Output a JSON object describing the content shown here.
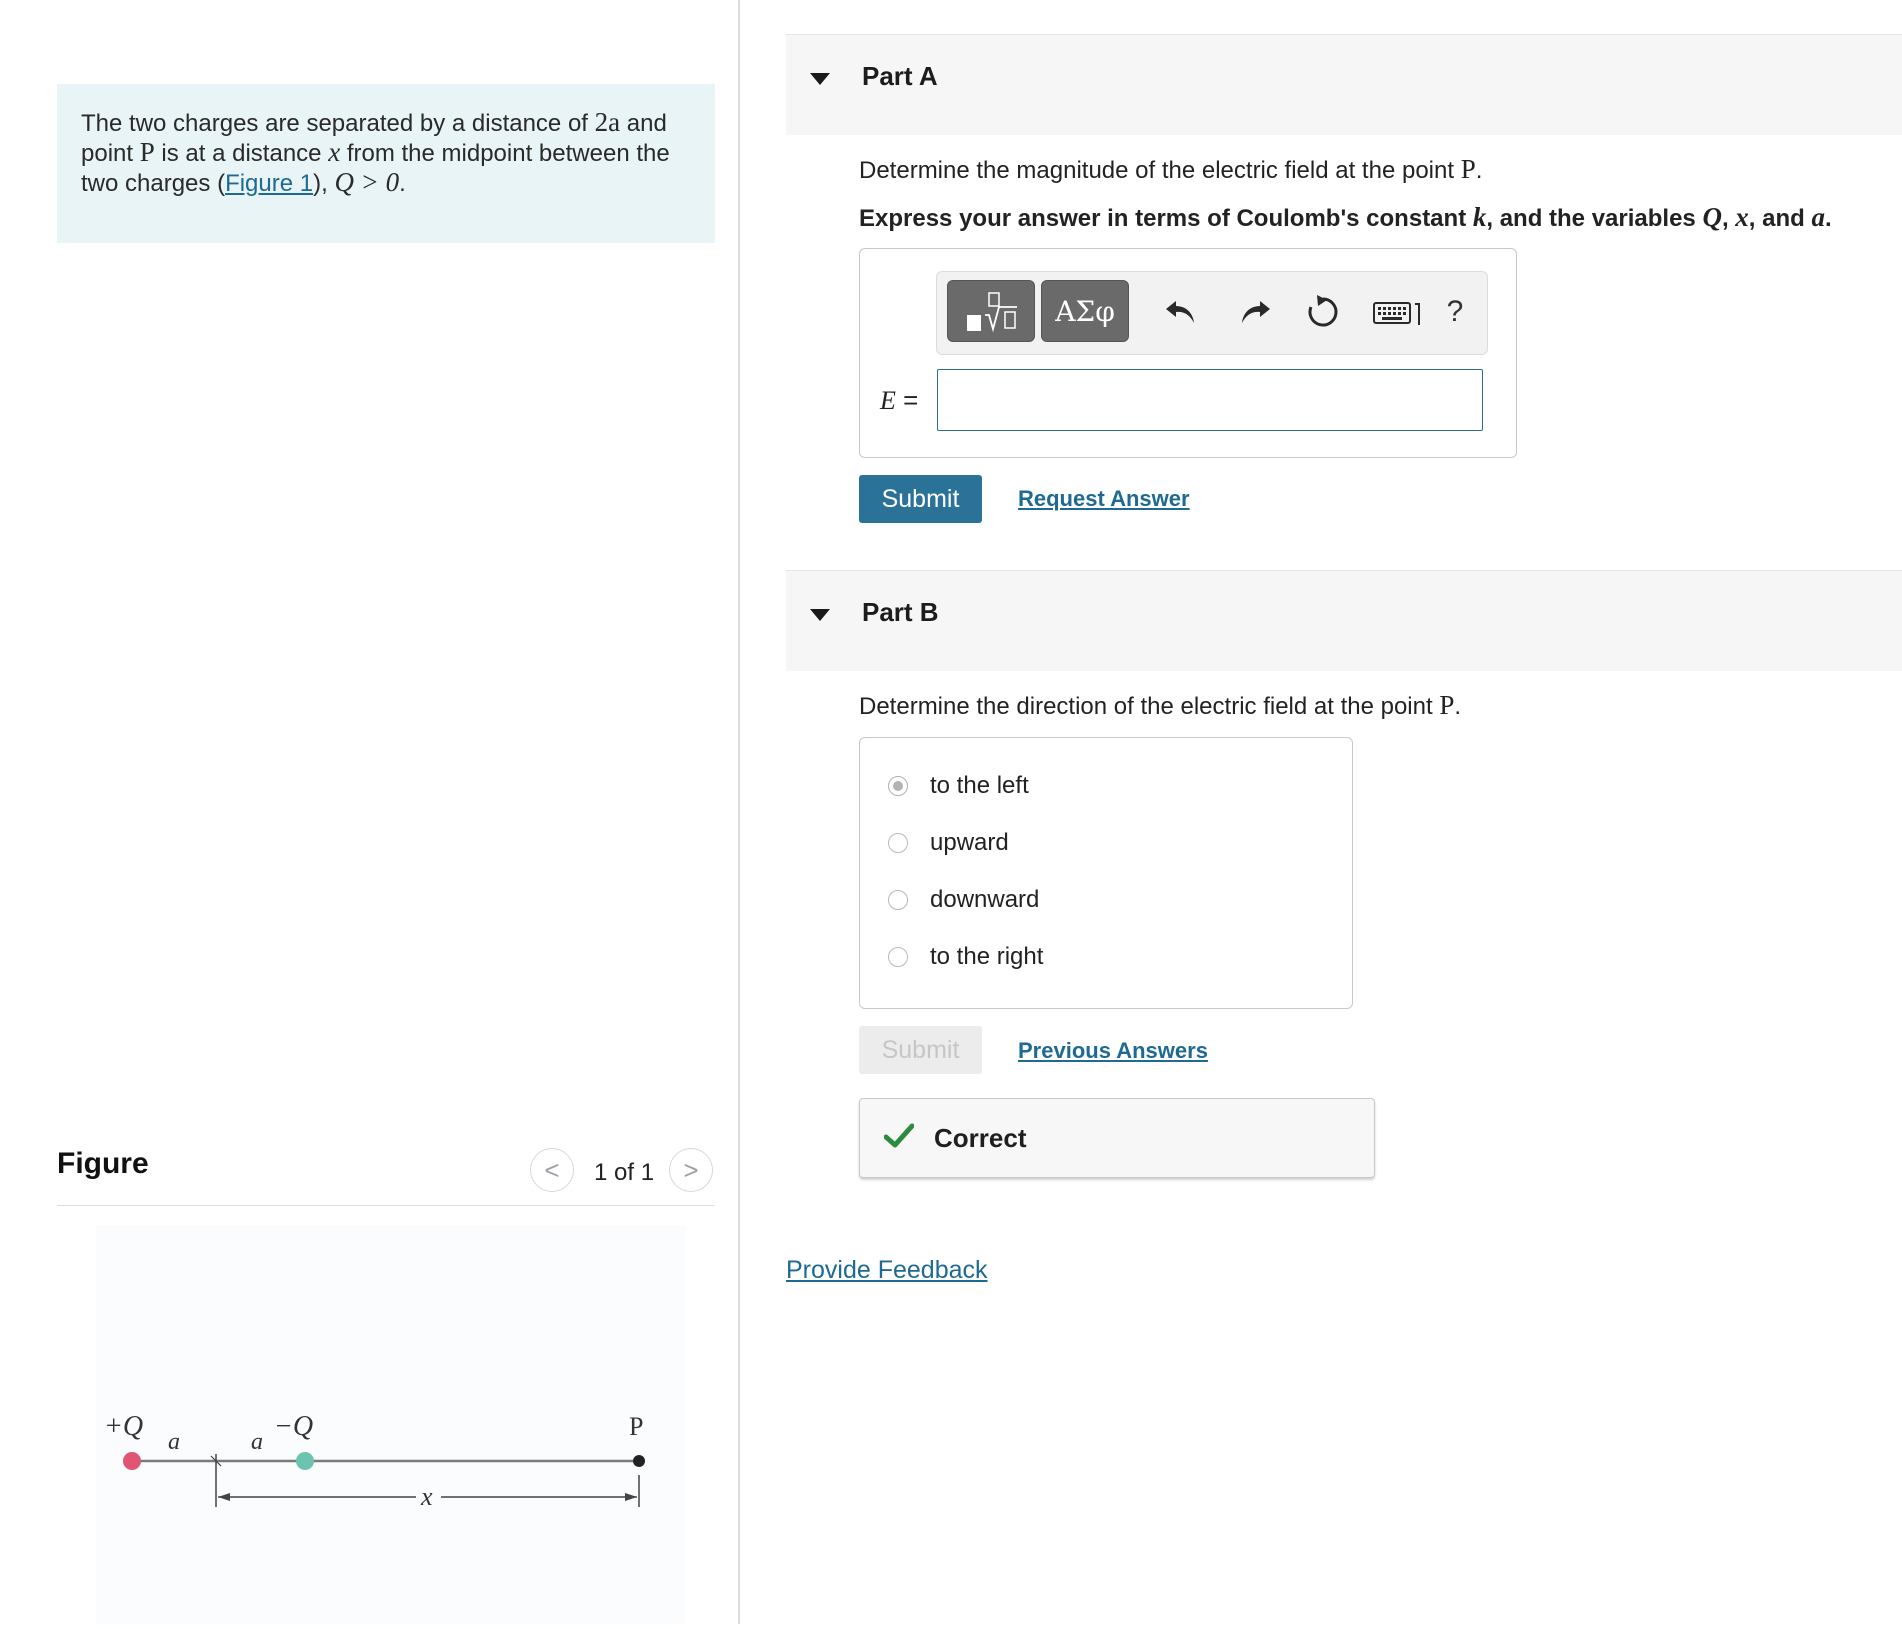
{
  "problem": {
    "t1": "The two charges are separated by a distance of ",
    "m1": "2a",
    "t2": " and",
    "t3": "point ",
    "m2": "P",
    "t4": " is at a distance ",
    "m3": "x",
    "t5": " from the midpoint between the",
    "t6": "two charges (",
    "figure_link": "Figure 1",
    "t7": "), ",
    "m4": "Q > 0",
    "t8": "."
  },
  "figure": {
    "heading": "Figure",
    "pager": "1 of 1",
    "prev_glyph": "<",
    "next_glyph": ">",
    "labels": {
      "plus_q": "+Q",
      "minus_q": "−Q",
      "a_left": "a",
      "a_right": "a",
      "point": "P",
      "x": "x"
    },
    "colors": {
      "positive_charge": "#e05574",
      "negative_charge": "#6cc3b0",
      "point": "#222222"
    }
  },
  "part_a": {
    "title": "Part A",
    "prompt_text": "Determine the magnitude of the electric field at the point ",
    "prompt_var": "P",
    "prompt_end": ".",
    "instr_1": "Express your answer in terms of Coulomb's constant ",
    "instr_k": "k",
    "instr_2": ", and the variables ",
    "instr_q": "Q",
    "instr_3": ", ",
    "instr_x": "x",
    "instr_4": ", and ",
    "instr_a": "a",
    "instr_5": ".",
    "toolbar": {
      "symbols_label": "ΑΣφ",
      "help_label": "?",
      "icons": [
        "templates-icon",
        "undo-icon",
        "redo-icon",
        "reset-icon",
        "keyboard-icon",
        "help-icon"
      ]
    },
    "eq_var": "E",
    "eq_sign": " =",
    "input_value": "",
    "submit_label": "Submit",
    "request_answer_label": "Request Answer"
  },
  "part_b": {
    "title": "Part B",
    "prompt_text": "Determine the direction of the electric field at the point ",
    "prompt_var": "P",
    "prompt_end": ".",
    "choices": [
      {
        "label": "to the left",
        "selected": true
      },
      {
        "label": "upward",
        "selected": false
      },
      {
        "label": "downward",
        "selected": false
      },
      {
        "label": "to the right",
        "selected": false
      }
    ],
    "submit_label": "Submit",
    "previous_answers_label": "Previous Answers",
    "feedback": "Correct"
  },
  "provide_feedback_label": "Provide Feedback",
  "colors": {
    "accent": "#2b7298",
    "link": "#1f6a93",
    "correct_check": "#2e8b3e",
    "intro_bg": "#e8f4f5"
  }
}
